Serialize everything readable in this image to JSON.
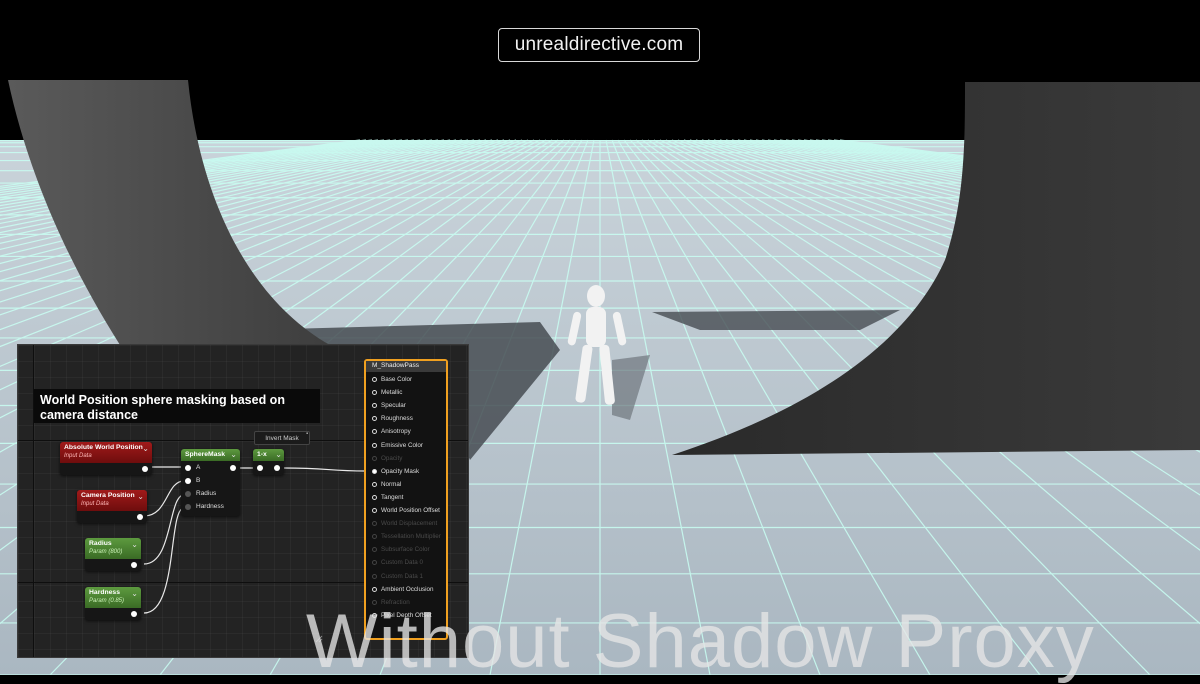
{
  "watermark": "unrealdirective.com",
  "caption": "Without Shadow Proxy",
  "comment": "World Position sphere masking based on camera distance",
  "nodes": {
    "abs_world_pos": {
      "title": "Absolute World Position",
      "sub": "Input Data"
    },
    "camera_pos": {
      "title": "Camera Position",
      "sub": "Input Data"
    },
    "radius": {
      "title": "Radius",
      "sub": "Param (800)"
    },
    "hardness": {
      "title": "Hardness",
      "sub": "Param (0.85)"
    },
    "spheremask": {
      "title": "SphereMask",
      "pins": [
        "A",
        "B",
        "Radius",
        "Hardness"
      ]
    },
    "oneminus": {
      "title": "1-x"
    },
    "invert_comment": "Invert Mask"
  },
  "material": {
    "title": "M_ShadowPass",
    "pins": [
      {
        "label": "Base Color",
        "state": "off-active"
      },
      {
        "label": "Metallic",
        "state": "off-active"
      },
      {
        "label": "Specular",
        "state": "off-active"
      },
      {
        "label": "Roughness",
        "state": "off-active"
      },
      {
        "label": "Anisotropy",
        "state": "off-active"
      },
      {
        "label": "Emissive Color",
        "state": "off-active"
      },
      {
        "label": "Opacity",
        "state": "disabled"
      },
      {
        "label": "Opacity Mask",
        "state": "connected"
      },
      {
        "label": "Normal",
        "state": "off-active"
      },
      {
        "label": "Tangent",
        "state": "off-active"
      },
      {
        "label": "World Position Offset",
        "state": "off-active"
      },
      {
        "label": "World Displacement",
        "state": "disabled"
      },
      {
        "label": "Tessellation Multiplier",
        "state": "disabled"
      },
      {
        "label": "Subsurface Color",
        "state": "disabled"
      },
      {
        "label": "Custom Data 0",
        "state": "disabled"
      },
      {
        "label": "Custom Data 1",
        "state": "disabled"
      },
      {
        "label": "Ambient Occlusion",
        "state": "off-active"
      },
      {
        "label": "Refraction",
        "state": "disabled"
      },
      {
        "label": "Pixel Depth Offset",
        "state": "off-active"
      }
    ]
  },
  "colors": {
    "accent": "#f0a020",
    "input_node": "#a11a1a",
    "param_node": "#5d9a3f",
    "grid_glow": "#9af5e3"
  }
}
